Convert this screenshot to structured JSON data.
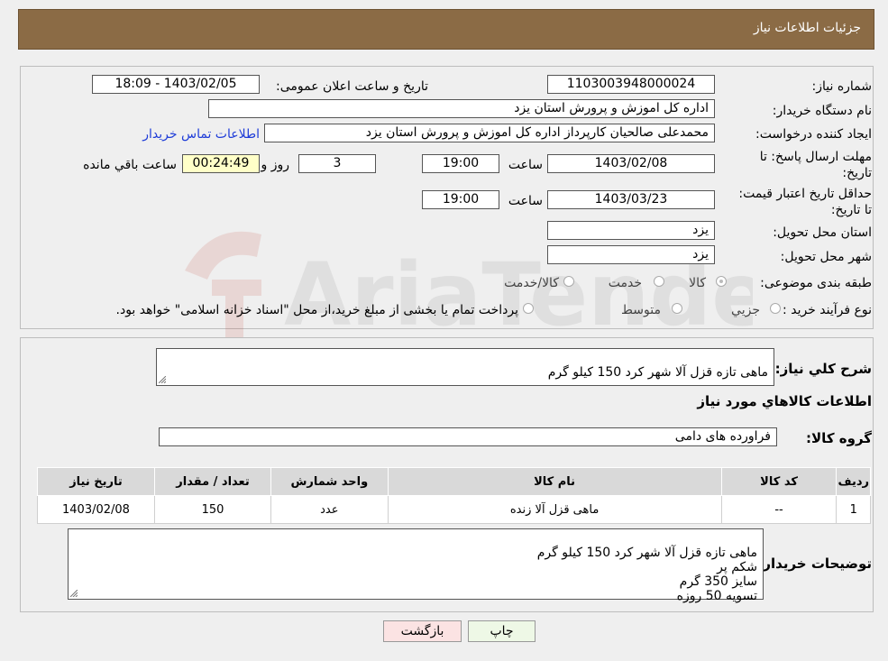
{
  "header": {
    "title": "جزئیات اطلاعات نیاز"
  },
  "info": {
    "need_number_label": "شماره نیاز:",
    "need_number": "1103003948000024",
    "announce_label": "تاریخ و ساعت اعلان عمومی:",
    "announce_value": "1403/02/05 - 18:09",
    "buyer_label": "نام دستگاه خریدار:",
    "buyer_value": "اداره کل اموزش و پرورش استان یزد",
    "creator_label": "ایجاد کننده درخواست:",
    "creator_value": "محمدعلی صالحیان کارپرداز اداره کل اموزش و پرورش استان یزد",
    "contact_link": "اطلاعات تماس خریدار",
    "deadline_label": "مهلت ارسال پاسخ: تا تاریخ:",
    "deadline_date": "1403/02/08",
    "time_label": "ساعت",
    "deadline_time": "19:00",
    "days_value": "3",
    "days_label": "روز و",
    "remaining_time": "00:24:49",
    "remaining_label": "ساعت باقي مانده",
    "validity_label": "حداقل تاریخ اعتبار قیمت: تا تاریخ:",
    "validity_date": "1403/03/23",
    "validity_time": "19:00",
    "province_label": "استان محل تحویل:",
    "province_value": "یزد",
    "city_label": "شهر محل تحویل:",
    "city_value": "یزد",
    "category_label": "طبقه بندی موضوعی:",
    "category_options": [
      "کالا",
      "خدمت",
      "کالا/خدمت"
    ],
    "process_label": "نوع فرآیند خرید :",
    "process_options": [
      "جزیي",
      "متوسط"
    ],
    "process_note": "پرداخت تمام یا بخشی از مبلغ خرید،از محل \"اسناد خزانه اسلامی\" خواهد بود."
  },
  "details": {
    "summary_label": "شرح كلي نياز:",
    "summary_value": "ماهی تازه قزل آلا شهر کرد 150 کیلو گرم",
    "goods_info_title": "اطلاعات كالاهاي مورد نياز",
    "group_label": "گروه كالا:",
    "group_value": "فراورده های دامی",
    "table_headers": [
      "رديف",
      "كد كالا",
      "نام كالا",
      "واحد شمارش",
      "تعداد / مقدار",
      "تاريخ نياز"
    ],
    "table_rows": [
      [
        "1",
        "--",
        "ماهی قزل آلا زنده",
        "عدد",
        "150",
        "1403/02/08"
      ]
    ],
    "buyer_notes_label": "توضيحات خريدار:",
    "buyer_notes_value": "ماهی تازه قزل آلا شهر کرد 150 کیلو گرم\nشکم پر\nسایز 350 گرم\nتسویه 50 روزه"
  },
  "buttons": {
    "print": "چاپ",
    "back": "بازگشت"
  },
  "watermark": "AriaTender.neT",
  "colors": {
    "header_bg": "#8b6b45",
    "link": "#1e3cd8",
    "print_bg": "#eef8e6",
    "back_bg": "#fbe3e3"
  }
}
